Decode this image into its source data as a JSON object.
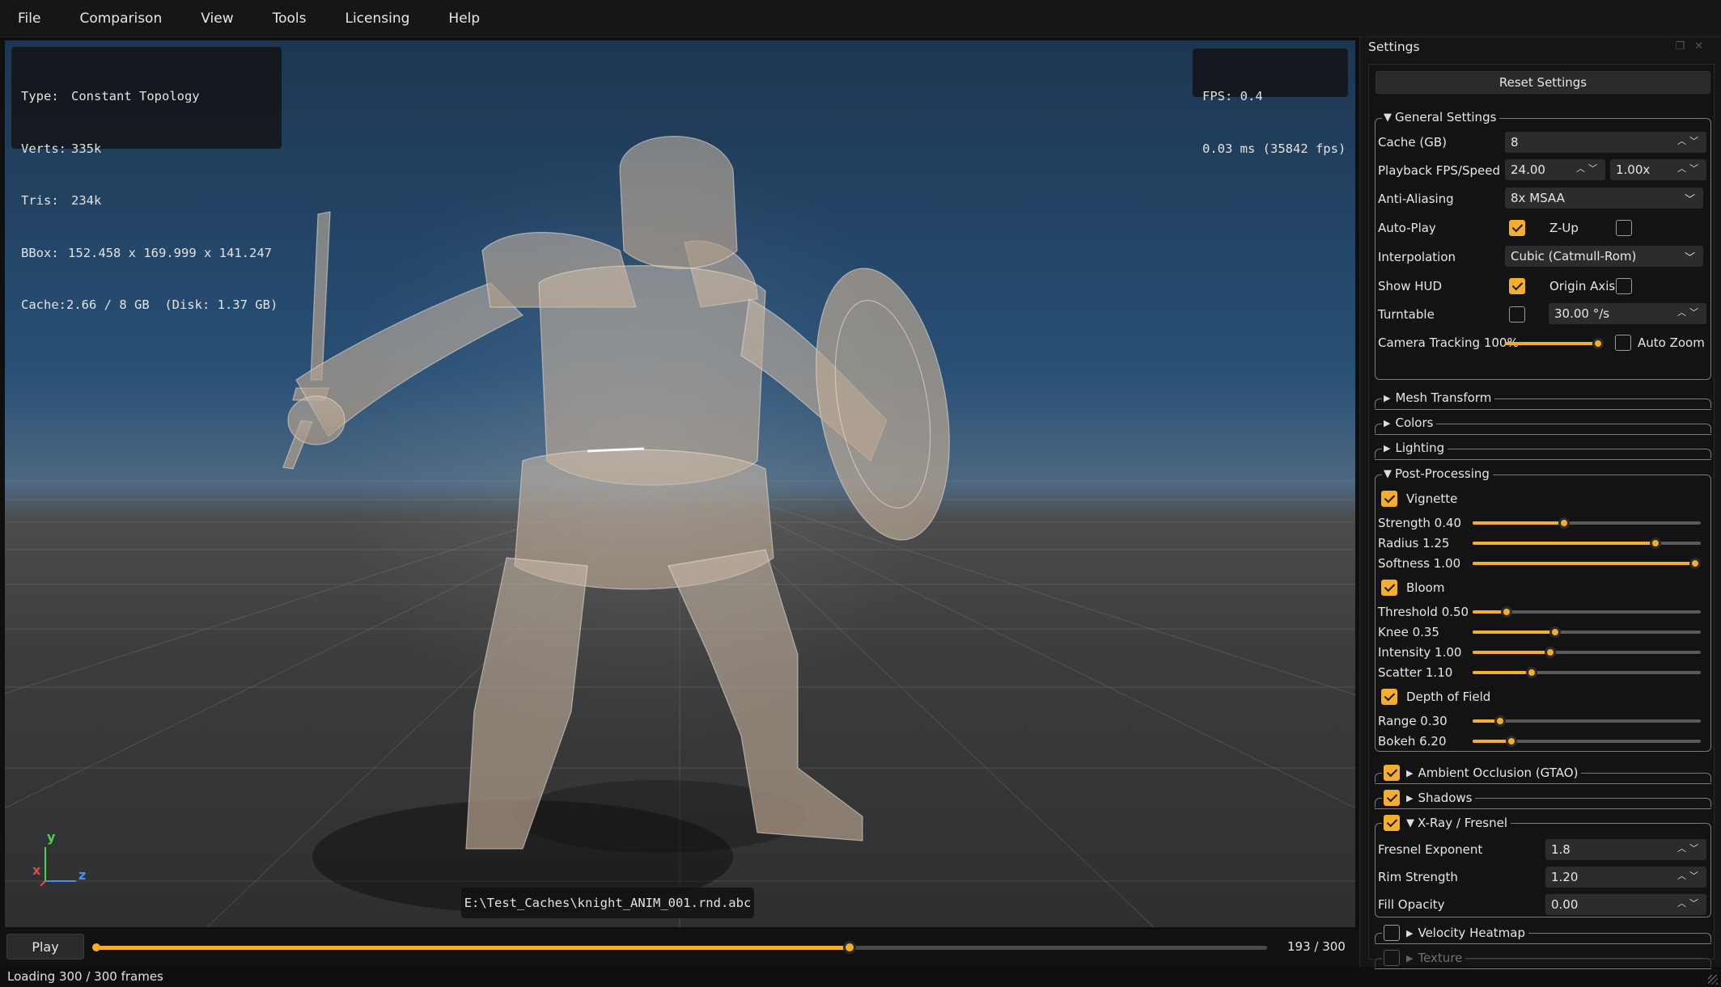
{
  "menu": [
    "File",
    "Comparison",
    "View",
    "Tools",
    "Licensing",
    "Help"
  ],
  "hud": {
    "stats": [
      {
        "k": "Type:",
        "v": "Constant Topology"
      },
      {
        "k": "Verts:",
        "v": "335k"
      },
      {
        "k": "Tris:",
        "v": "234k"
      },
      {
        "k": "BBox:",
        "v": "152.458 x 169.999 x 141.247"
      },
      {
        "k": "Cache:",
        "v": "2.66 / 8 GB  (Disk: 1.37 GB)"
      }
    ],
    "fps": "FPS: 0.4",
    "frametime": "0.03 ms (35842 fps)",
    "filepath": "E:\\Test_Caches\\knight_ANIM_001.rnd.abc"
  },
  "axes": {
    "y": "y",
    "x": "x",
    "z": "z",
    "colors": {
      "x": "#e24a4a",
      "y": "#4bd14b",
      "z": "#4a8ef0"
    }
  },
  "timeline": {
    "play_label": "Play",
    "current": 193,
    "total": 300,
    "frame_label": "193 / 300"
  },
  "status": {
    "text": "Loading 300 / 300 frames"
  },
  "colors": {
    "accent": "#f4ad2c"
  },
  "settings": {
    "title": "Settings",
    "reset_label": "Reset Settings",
    "general": {
      "title": "General Settings",
      "cache_label": "Cache (GB)",
      "cache_value": "8",
      "fps_label": "Playback FPS/Speed",
      "fps_value": "24.00",
      "speed_value": "1.00x",
      "aa_label": "Anti-Aliasing",
      "aa_value": "8x MSAA",
      "autoplay_label": "Auto-Play",
      "autoplay": true,
      "zup_label": "Z-Up",
      "zup": false,
      "interp_label": "Interpolation",
      "interp_value": "Cubic (Catmull-Rom)",
      "showhud_label": "Show HUD",
      "showhud": true,
      "origin_label": "Origin Axis",
      "origin": false,
      "turntable_label": "Turntable",
      "turntable": false,
      "turntable_value": "30.00 °/s",
      "tracking_label": "Camera Tracking 100%",
      "tracking": 1.0,
      "autozoom_label": "Auto Zoom",
      "autozoom": false
    },
    "collapsed": [
      "Mesh Transform",
      "Colors",
      "Lighting"
    ],
    "post": {
      "title": "Post-Processing",
      "vignette_label": "Vignette",
      "strength_label": "Strength 0.40",
      "strength": 0.4,
      "radius_label": "Radius 1.25",
      "radius": 0.8,
      "softness_label": "Softness 1.00",
      "softness": 1.0,
      "bloom_label": "Bloom",
      "threshold_label": "Threshold 0.50",
      "threshold": 0.15,
      "knee_label": "Knee 0.35",
      "knee": 0.36,
      "intensity_label": "Intensity 1.00",
      "intensity": 0.34,
      "scatter_label": "Scatter 1.10",
      "scatter": 0.26,
      "dof_label": "Depth of Field",
      "range_label": "Range 0.30",
      "range": 0.12,
      "bokeh_label": "Bokeh 6.20",
      "bokeh": 0.17
    },
    "ao_label": "Ambient Occlusion (GTAO)",
    "shadows_label": "Shadows",
    "xray": {
      "title": "X-Ray / Fresnel",
      "fresnel_label": "Fresnel Exponent",
      "fresnel_value": "1.8",
      "rim_label": "Rim Strength",
      "rim_value": "1.20",
      "fill_label": "Fill Opacity",
      "fill_value": "0.00"
    },
    "velocity_label": "Velocity Heatmap",
    "texture_label": "Texture"
  }
}
